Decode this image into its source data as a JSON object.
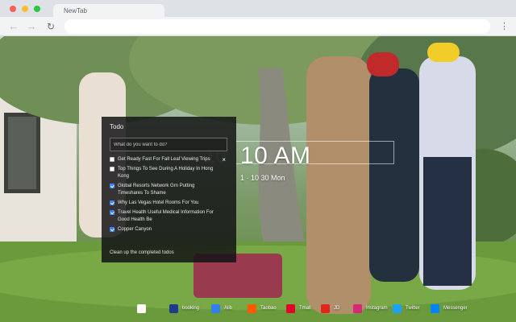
{
  "browser": {
    "tab_title": "NewTab",
    "back_glyph": "←",
    "forward_glyph": "→",
    "reload_glyph": "↻",
    "menu_glyph": "⋮"
  },
  "todo": {
    "title": "Todo",
    "placeholder": "What do you want to do?",
    "items": [
      {
        "text": "Get Ready Fast For Fall Leaf Viewing Trips",
        "done": false
      },
      {
        "text": "Top Things To See During A Holiday In Hong Kong",
        "done": false
      },
      {
        "text": "Global Resorts Network Grn Putting Timeshares To Shame",
        "done": true
      },
      {
        "text": "Why Las Vegas Hotel Rooms For You",
        "done": true
      },
      {
        "text": "Travel Health Useful Medical Information For Good Health Be",
        "done": true
      },
      {
        "text": "Copper Canyon",
        "done": true
      }
    ],
    "delete_glyph": "×",
    "cleanup_label": "Clean up the completed todos"
  },
  "clock": {
    "time": "10 AM",
    "ghost": "10",
    "date": "1 · 10 30 Mon"
  },
  "shortcuts": [
    {
      "label": "",
      "icon": "blank-icon",
      "color": "#ffffff"
    },
    {
      "label": "booking",
      "icon": "booking-icon",
      "color": "#1e3c8c"
    },
    {
      "label": "Alib",
      "icon": "alibaba-icon",
      "color": "#2f80ed"
    },
    {
      "label": "Taobao",
      "icon": "taobao-icon",
      "color": "#ff5a00"
    },
    {
      "label": "Tmall",
      "icon": "tmall-icon",
      "color": "#e4002b"
    },
    {
      "label": "JD",
      "icon": "jd-icon",
      "color": "#e1251b"
    },
    {
      "label": "Instagram",
      "icon": "instagram-icon",
      "color": "#d62976"
    },
    {
      "label": "Twitter",
      "icon": "twitter-icon",
      "color": "#1da1f2"
    },
    {
      "label": "Messenger",
      "icon": "messenger-icon",
      "color": "#0084ff"
    }
  ]
}
